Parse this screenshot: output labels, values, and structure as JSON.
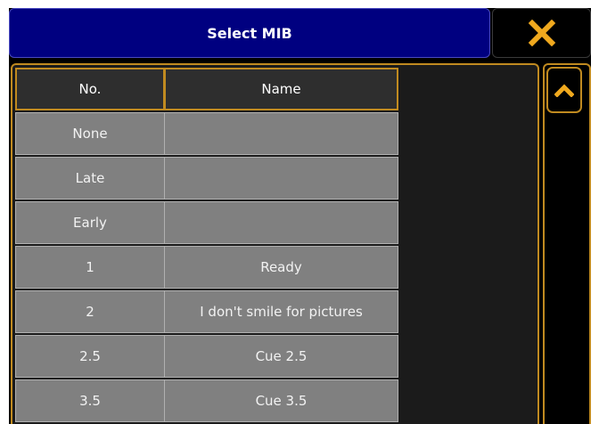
{
  "window": {
    "title": "Select MIB",
    "close_icon": "close-x-icon",
    "accent": "#c08a20",
    "title_bg": "#000080"
  },
  "table": {
    "columns": [
      "No.",
      "Name"
    ],
    "rows": [
      {
        "no": "None",
        "name": ""
      },
      {
        "no": "Late",
        "name": ""
      },
      {
        "no": "Early",
        "name": ""
      },
      {
        "no": "1",
        "name": "Ready"
      },
      {
        "no": "2",
        "name": "I don't smile for pictures"
      },
      {
        "no": "2.5",
        "name": "Cue 2.5"
      },
      {
        "no": "3.5",
        "name": "Cue 3.5"
      }
    ]
  },
  "scrollbar": {
    "up_icon": "chevron-up-icon"
  }
}
